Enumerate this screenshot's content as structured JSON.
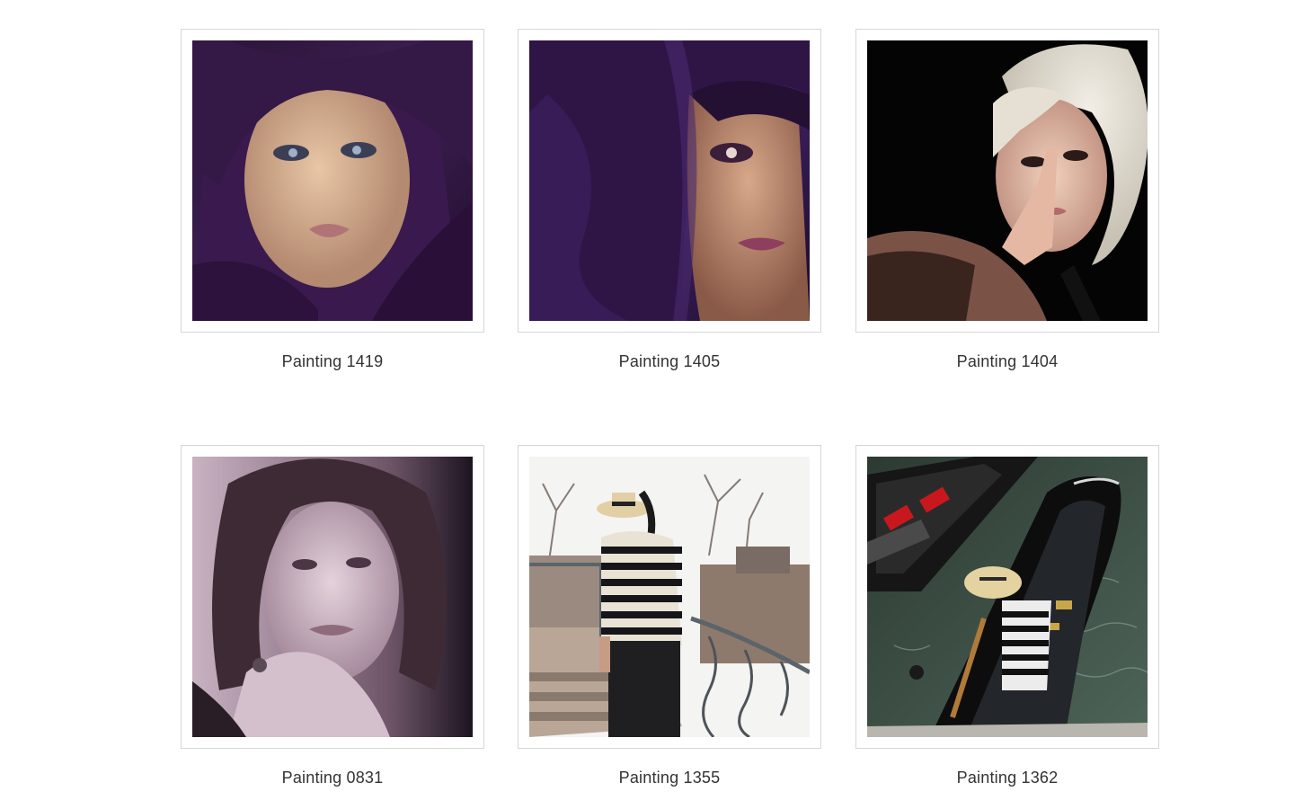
{
  "gallery": {
    "items": [
      {
        "caption": "Painting 1419"
      },
      {
        "caption": "Painting 1405"
      },
      {
        "caption": "Painting 1404"
      },
      {
        "caption": "Painting 0831"
      },
      {
        "caption": "Painting 1355"
      },
      {
        "caption": "Painting 1362"
      }
    ]
  },
  "colors": {
    "frame_border": "#d6d6d6",
    "caption_text": "#333333",
    "background": "#ffffff"
  }
}
